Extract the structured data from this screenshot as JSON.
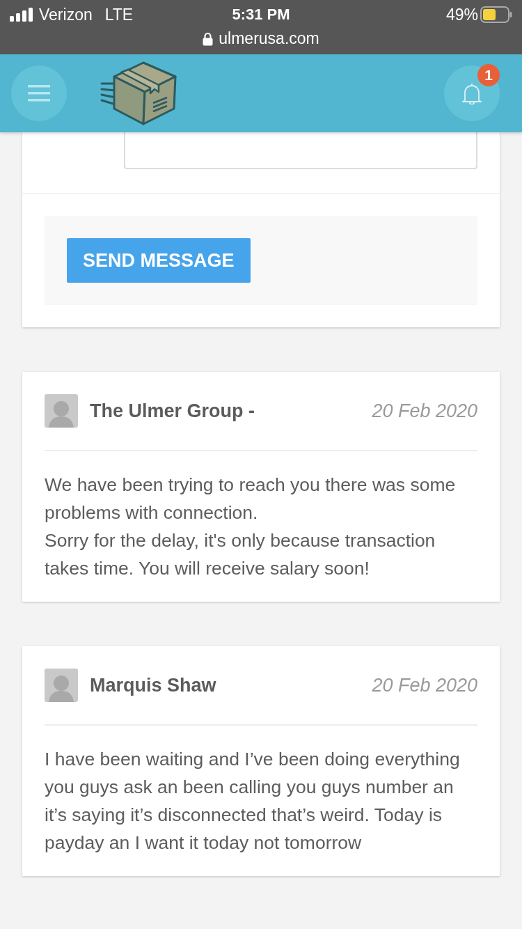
{
  "status_bar": {
    "carrier": "Verizon",
    "network": "LTE",
    "time": "5:31 PM",
    "battery": "49%",
    "url": "ulmerusa.com"
  },
  "header": {
    "notification_count": "1"
  },
  "compose": {
    "button": "SEND MESSAGE"
  },
  "messages": [
    {
      "author": "The Ulmer Group -",
      "date": "20 Feb 2020",
      "body": "We have been trying to reach you there was some problems with connection.\nSorry for the delay, it's only because transaction takes time. You will receive salary soon!"
    },
    {
      "author": "Marquis Shaw",
      "date": "20 Feb 2020",
      "body": "I have been waiting and I’ve been doing everything you guys ask an been calling you guys number an it’s saying it’s disconnected that’s weird. Today is payday an I want it today not tomorrow"
    }
  ]
}
